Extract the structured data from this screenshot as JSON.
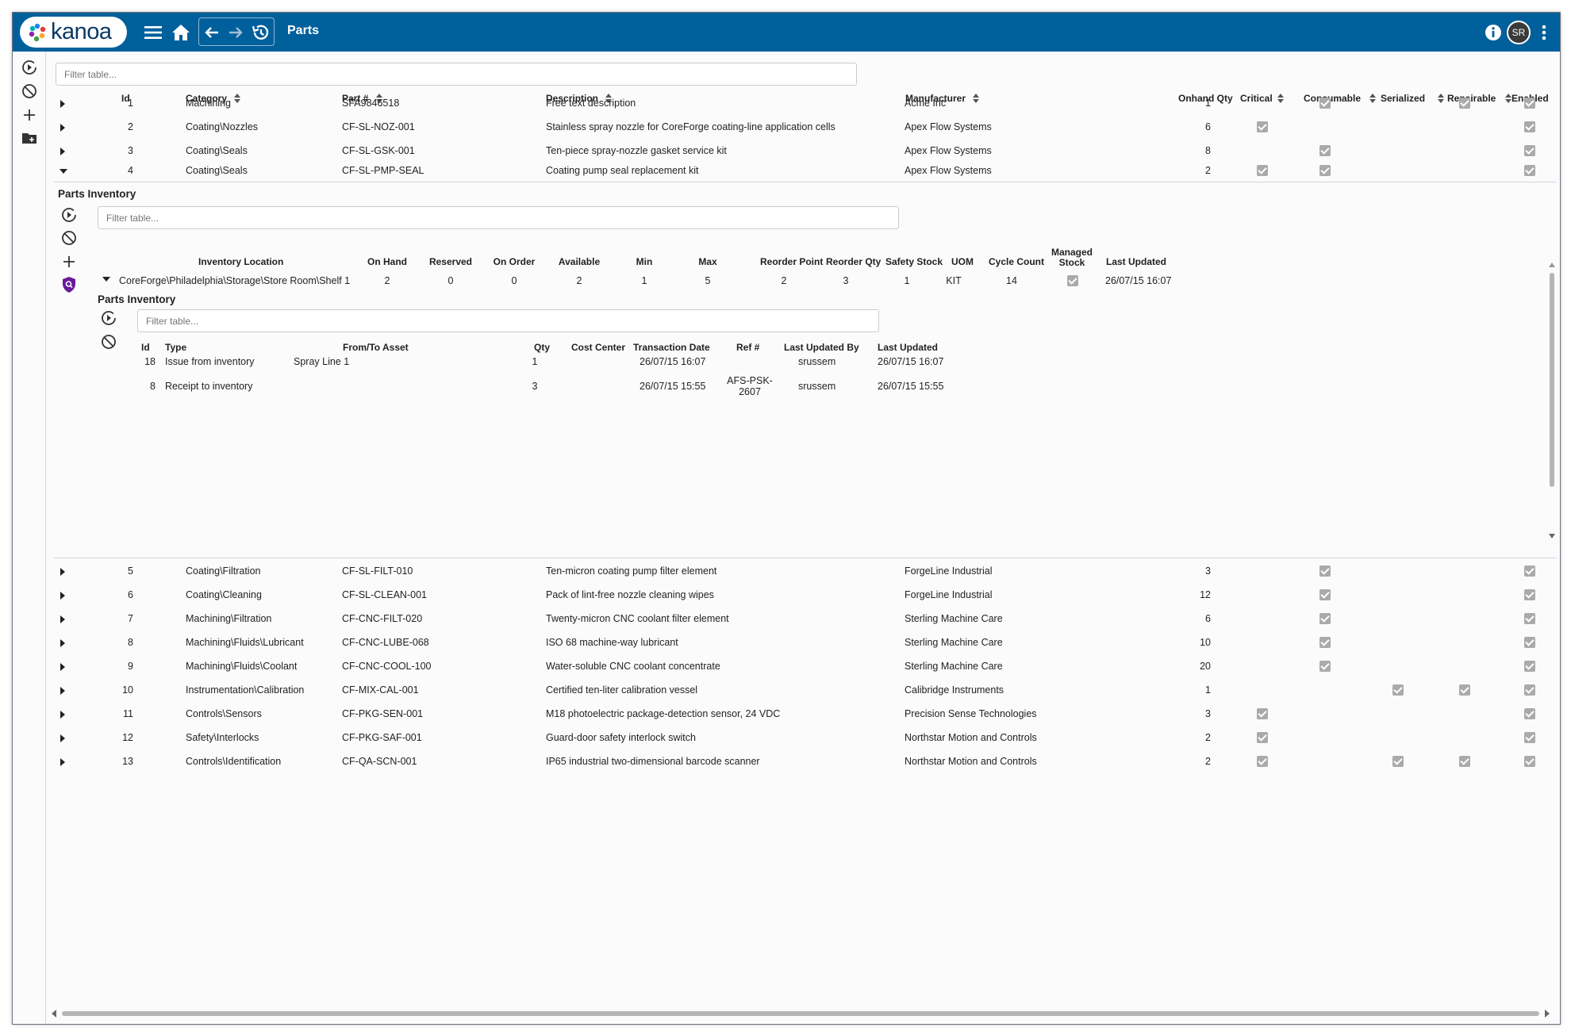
{
  "app": {
    "logo_text": "kanoa",
    "page_title": "Parts",
    "avatar_initials": "SR",
    "brand_color": "#00609c"
  },
  "toolbar": {
    "icons": [
      "menu-icon",
      "home-icon",
      "back-icon",
      "forward-icon",
      "history-icon",
      "info-icon",
      "more-icon"
    ]
  },
  "sidebar": {
    "icons": [
      "refresh-icon",
      "clear-filters-icon",
      "add-icon",
      "add-folder-icon"
    ]
  },
  "parts": {
    "filter_placeholder": "Filter table...",
    "columns": {
      "id": "Id",
      "category": "Category",
      "part": "Part #",
      "description": "Description",
      "manufacturer": "Manufacturer",
      "onhand": "Onhand Qty",
      "critical": "Critical",
      "consumable": "Consumable",
      "serialized": "Serialized",
      "repairable": "Repairable",
      "enabled": "Enabled"
    },
    "rows": [
      {
        "id": "1",
        "category": "Machining",
        "part": "SFA9846518",
        "description": "Free text description",
        "manufacturer": "Acme Inc",
        "onhand": "1",
        "critical": false,
        "consumable": true,
        "serialized": false,
        "repairable": true,
        "enabled": true
      },
      {
        "id": "2",
        "category": "Coating\\Nozzles",
        "part": "CF-SL-NOZ-001",
        "description": "Stainless spray nozzle for CoreForge coating-line application cells",
        "manufacturer": "Apex Flow Systems",
        "onhand": "6",
        "critical": true,
        "consumable": false,
        "serialized": false,
        "repairable": false,
        "enabled": true
      },
      {
        "id": "3",
        "category": "Coating\\Seals",
        "part": "CF-SL-GSK-001",
        "description": "Ten-piece spray-nozzle gasket service kit",
        "manufacturer": "Apex Flow Systems",
        "onhand": "8",
        "critical": false,
        "consumable": true,
        "serialized": false,
        "repairable": false,
        "enabled": true
      },
      {
        "id": "4",
        "category": "Coating\\Seals",
        "part": "CF-SL-PMP-SEAL",
        "description": "Coating pump seal replacement kit",
        "manufacturer": "Apex Flow Systems",
        "onhand": "2",
        "critical": true,
        "consumable": true,
        "serialized": false,
        "repairable": false,
        "enabled": true,
        "expanded": true
      },
      {
        "id": "5",
        "category": "Coating\\Filtration",
        "part": "CF-SL-FILT-010",
        "description": "Ten-micron coating pump filter element",
        "manufacturer": "ForgeLine Industrial",
        "onhand": "3",
        "critical": false,
        "consumable": true,
        "serialized": false,
        "repairable": false,
        "enabled": true
      },
      {
        "id": "6",
        "category": "Coating\\Cleaning",
        "part": "CF-SL-CLEAN-001",
        "description": "Pack of lint-free nozzle cleaning wipes",
        "manufacturer": "ForgeLine Industrial",
        "onhand": "12",
        "critical": false,
        "consumable": true,
        "serialized": false,
        "repairable": false,
        "enabled": true
      },
      {
        "id": "7",
        "category": "Machining\\Filtration",
        "part": "CF-CNC-FILT-020",
        "description": "Twenty-micron CNC coolant filter element",
        "manufacturer": "Sterling Machine Care",
        "onhand": "6",
        "critical": false,
        "consumable": true,
        "serialized": false,
        "repairable": false,
        "enabled": true
      },
      {
        "id": "8",
        "category": "Machining\\Fluids\\Lubricant",
        "part": "CF-CNC-LUBE-068",
        "description": "ISO 68 machine-way lubricant",
        "manufacturer": "Sterling Machine Care",
        "onhand": "10",
        "critical": false,
        "consumable": true,
        "serialized": false,
        "repairable": false,
        "enabled": true
      },
      {
        "id": "9",
        "category": "Machining\\Fluids\\Coolant",
        "part": "CF-CNC-COOL-100",
        "description": "Water-soluble CNC coolant concentrate",
        "manufacturer": "Sterling Machine Care",
        "onhand": "20",
        "critical": false,
        "consumable": true,
        "serialized": false,
        "repairable": false,
        "enabled": true
      },
      {
        "id": "10",
        "category": "Instrumentation\\Calibration",
        "part": "CF-MIX-CAL-001",
        "description": "Certified ten-liter calibration vessel",
        "manufacturer": "Calibridge Instruments",
        "onhand": "1",
        "critical": false,
        "consumable": false,
        "serialized": true,
        "repairable": true,
        "enabled": true
      },
      {
        "id": "11",
        "category": "Controls\\Sensors",
        "part": "CF-PKG-SEN-001",
        "description": "M18 photoelectric package-detection sensor, 24 VDC",
        "manufacturer": "Precision Sense Technologies",
        "onhand": "3",
        "critical": true,
        "consumable": false,
        "serialized": false,
        "repairable": false,
        "enabled": true
      },
      {
        "id": "12",
        "category": "Safety\\Interlocks",
        "part": "CF-PKG-SAF-001",
        "description": "Guard-door safety interlock switch",
        "manufacturer": "Northstar Motion and Controls",
        "onhand": "2",
        "critical": true,
        "consumable": false,
        "serialized": false,
        "repairable": false,
        "enabled": true
      },
      {
        "id": "13",
        "category": "Controls\\Identification",
        "part": "CF-QA-SCN-001",
        "description": "IP65 industrial two-dimensional barcode scanner",
        "manufacturer": "Northstar Motion and Controls",
        "onhand": "2",
        "critical": true,
        "consumable": false,
        "serialized": true,
        "repairable": true,
        "enabled": true
      }
    ]
  },
  "inventory": {
    "title": "Parts Inventory",
    "filter_placeholder": "Filter table...",
    "columns": {
      "location": "Inventory Location",
      "onhand": "On Hand",
      "reserved": "Reserved",
      "onorder": "On Order",
      "available": "Available",
      "min": "Min",
      "max": "Max",
      "reorder_point": "Reorder Point",
      "reorder_qty": "Reorder Qty",
      "safety": "Safety Stock",
      "uom": "UOM",
      "cycle": "Cycle Count",
      "managed": "Managed Stock",
      "last_updated": "Last Updated"
    },
    "row": {
      "location": "CoreForge\\Philadelphia\\Storage\\Store Room\\Shelf 1",
      "onhand": "2",
      "reserved": "0",
      "onorder": "0",
      "available": "2",
      "min": "1",
      "max": "5",
      "reorder_point": "2",
      "reorder_qty": "3",
      "safety": "1",
      "uom": "KIT",
      "cycle": "14",
      "managed": true,
      "last_updated": "26/07/15 16:07"
    }
  },
  "transactions": {
    "title": "Parts Inventory",
    "filter_placeholder": "Filter table...",
    "columns": {
      "id": "Id",
      "type": "Type",
      "asset": "From/To Asset",
      "qty": "Qty",
      "cost_center": "Cost Center",
      "date": "Transaction Date",
      "ref": "Ref #",
      "updated_by": "Last Updated By",
      "last_updated": "Last Updated"
    },
    "rows": [
      {
        "id": "18",
        "type": "Issue from inventory",
        "asset": "Spray Line 1",
        "qty": "1",
        "cost_center": "",
        "date": "26/07/15 16:07",
        "ref": "",
        "updated_by": "srussem",
        "last_updated": "26/07/15 16:07"
      },
      {
        "id": "8",
        "type": "Receipt to inventory",
        "asset": "",
        "qty": "3",
        "cost_center": "",
        "date": "26/07/15 15:55",
        "ref": "AFS-PSK-2607",
        "updated_by": "srussem",
        "last_updated": "26/07/15 15:55"
      }
    ]
  }
}
